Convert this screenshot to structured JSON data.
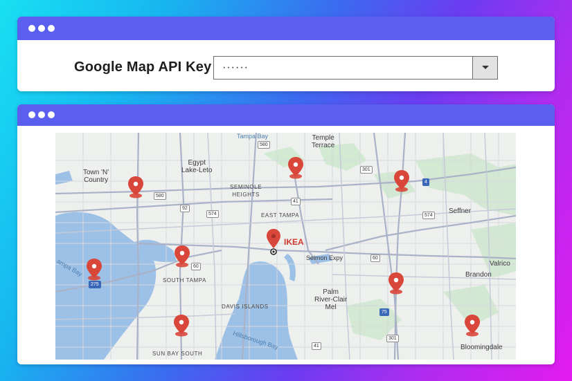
{
  "settings_window": {
    "label": "Google Map API Key",
    "api_key_value": "······"
  },
  "map": {
    "places": {
      "tampa_bay": "Tampa Bay",
      "temple_terrace": "Temple\nTerrace",
      "town_n_country": "Town 'N'\nCountry",
      "egypt_lake_leto": "Egypt\nLake-Leto",
      "seminole_heights": "SEMINOLE\nHEIGHTS",
      "east_tampa": "EAST TAMPA",
      "seffner": "Seffner",
      "ikea": "IKEA",
      "salmon_expy": "Selmon Expy",
      "south_tampa": "SOUTH TAMPA",
      "valrico": "Valrico",
      "brandon": "Brandon",
      "davis_islands": "DAVIS ISLANDS",
      "palm_river_clair_mel": "Palm\nRiver-Clair\nMel",
      "hillsborough_bay": "Hillsborough Bay",
      "bloomingdale": "Bloomingdale",
      "sun_bay_south": "SUN BAY SOUTH",
      "ampa_bay": "ampa Bay"
    },
    "shields": [
      "580",
      "301",
      "580",
      "92",
      "574",
      "41",
      "4",
      "574",
      "60",
      "60",
      "92",
      "275",
      "75",
      "301",
      "41"
    ]
  },
  "colors": {
    "titlebar": "#5a5ff0",
    "water": "#9cc0e6",
    "pin": "#d9473a"
  }
}
